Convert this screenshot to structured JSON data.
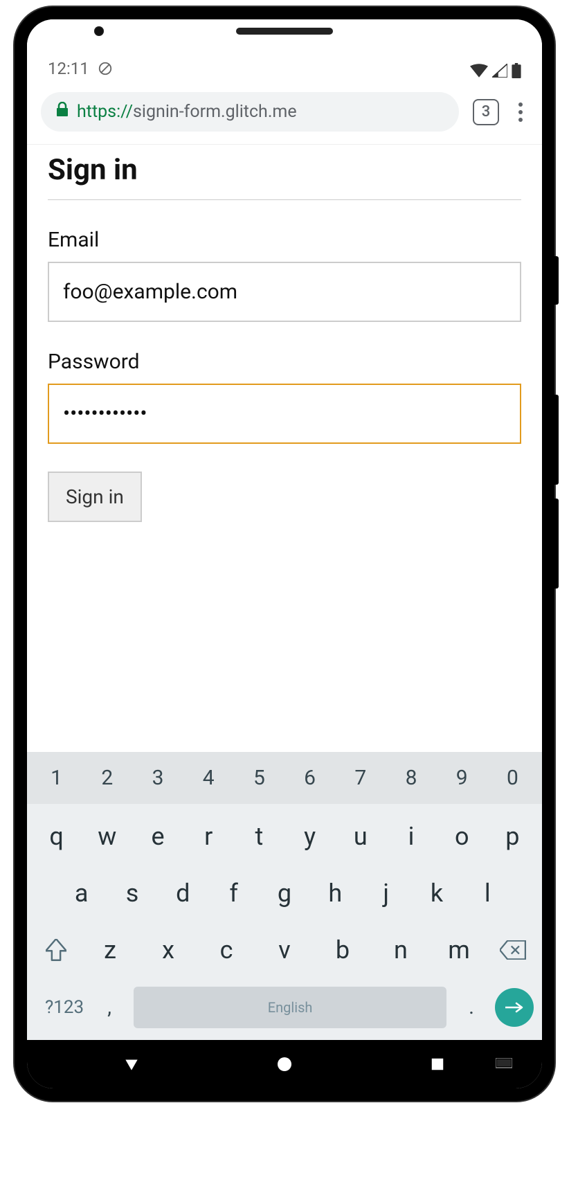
{
  "status": {
    "time": "12:11",
    "tab_count": "3"
  },
  "url": {
    "scheme": "https://",
    "host": "signin-form.glitch.me"
  },
  "page": {
    "title": "Sign in",
    "email_label": "Email",
    "email_value": "foo@example.com",
    "password_label": "Password",
    "password_value": "••••••••••••",
    "submit_label": "Sign in"
  },
  "keyboard": {
    "numbers": [
      "1",
      "2",
      "3",
      "4",
      "5",
      "6",
      "7",
      "8",
      "9",
      "0"
    ],
    "row1": [
      "q",
      "w",
      "e",
      "r",
      "t",
      "y",
      "u",
      "i",
      "o",
      "p"
    ],
    "row2": [
      "a",
      "s",
      "d",
      "f",
      "g",
      "h",
      "j",
      "k",
      "l"
    ],
    "row3": [
      "z",
      "x",
      "c",
      "v",
      "b",
      "n",
      "m"
    ],
    "sym": "?123",
    "comma": ",",
    "space": "English",
    "period": "."
  }
}
